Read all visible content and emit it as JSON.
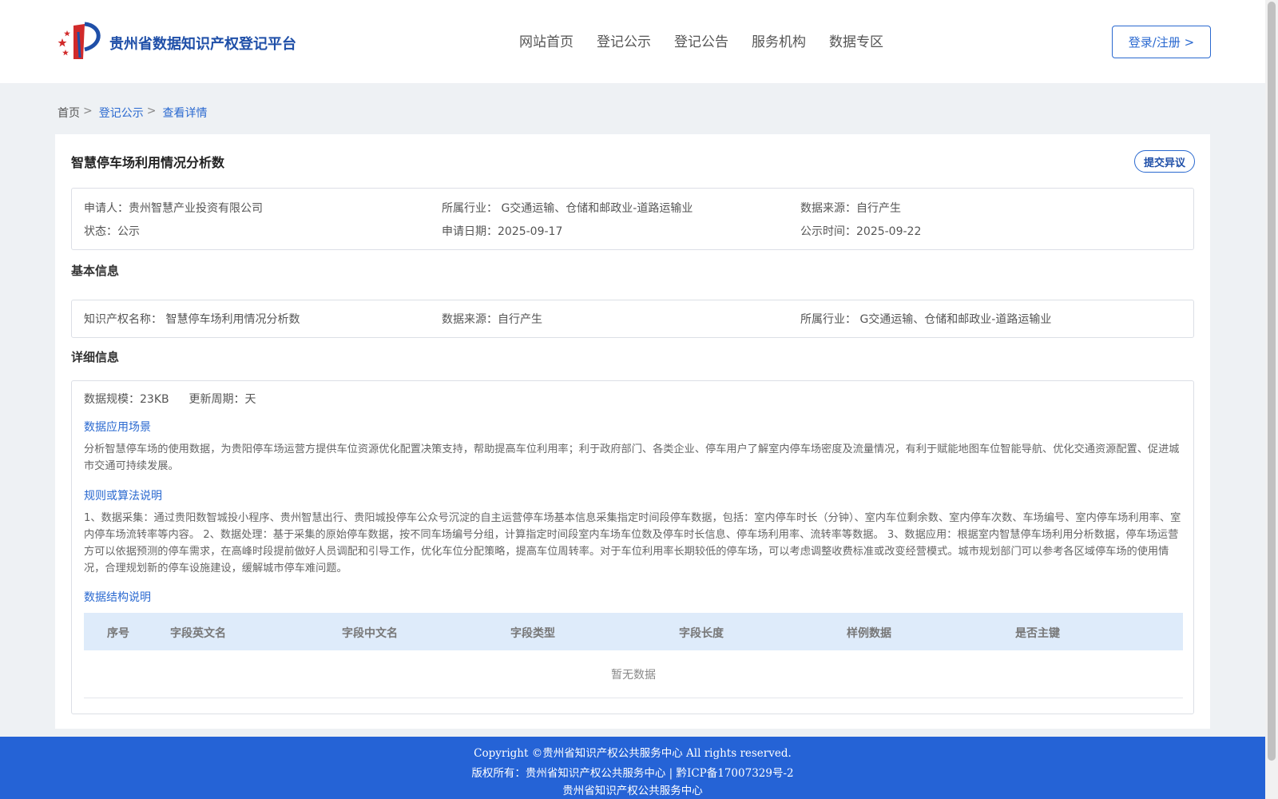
{
  "header": {
    "site_title": "贵州省数据知识产权登记平台",
    "nav": [
      "网站首页",
      "登记公示",
      "登记公告",
      "服务机构",
      "数据专区"
    ],
    "login_label": "登录/注册 >"
  },
  "breadcrumb": {
    "home": "首页",
    "sep": ">",
    "items": [
      "登记公示",
      "查看详情"
    ]
  },
  "record": {
    "title": "智慧停车场利用情况分析数",
    "objection_label": "提交异议",
    "meta": {
      "applicant_label": "申请人：",
      "applicant": "贵州智慧产业投资有限公司",
      "industry_label": "所属行业：",
      "industry": "G交通运输、仓储和邮政业-道路运输业",
      "source_label": "数据来源：",
      "source": "自行产生",
      "status_label": "状态：",
      "status": "公示",
      "apply_date_label": "申请日期：",
      "apply_date": "2025-09-17",
      "publish_time_label": "公示时间：",
      "publish_time": "2025-09-22"
    }
  },
  "basic_info": {
    "title": "基本信息",
    "ip_name_label": "知识产权名称：",
    "ip_name": "智慧停车场利用情况分析数",
    "source_label": "数据来源：",
    "source": "自行产生",
    "industry_label": "所属行业：",
    "industry": "G交通运输、仓储和邮政业-道路运输业"
  },
  "detail_info": {
    "title": "详细信息",
    "scale_label": "数据规模：",
    "scale": "23KB",
    "cycle_label": "更新周期：",
    "cycle": "天",
    "scenario_title": "数据应用场景",
    "scenario_text": "分析智慧停车场的使用数据，为贵阳停车场运营方提供车位资源优化配置决策支持，帮助提高车位利用率；利于政府部门、各类企业、停车用户了解室内停车场密度及流量情况，有利于赋能地图车位智能导航、优化交通资源配置、促进城市交通可持续发展。",
    "algorithm_title": "规则或算法说明",
    "algorithm_text": "1、数据采集：通过贵阳数智城投小程序、贵州智慧出行、贵阳城投停车公众号沉淀的自主运营停车场基本信息采集指定时间段停车数据，包括：室内停车时长（分钟）、室内车位剩余数、室内停车次数、车场编号、室内停车场利用率、室内停车场流转率等内容。 2、数据处理：基于采集的原始停车数据，按不同车场编号分组，计算指定时间段室内车场车位数及停车时长信息、停车场利用率、流转率等数据。 3、数据应用：根据室内智慧停车场利用分析数据，停车场运营方可以依据预测的停车需求，在高峰时段提前做好人员调配和引导工作，优化车位分配策略，提高车位周转率。对于车位利用率长期较低的停车场，可以考虑调整收费标准或改变经营模式。城市规划部门可以参考各区域停车场的使用情况，合理规划新的停车设施建设，缓解城市停车难问题。",
    "structure_title": "数据结构说明",
    "table_headers": [
      "序号",
      "字段英文名",
      "字段中文名",
      "字段类型",
      "字段长度",
      "样例数据",
      "是否主键"
    ],
    "table_empty": "暂无数据"
  },
  "footer": {
    "copyright": "Copyright ©贵州省知识产权公共服务中心 All rights reserved.",
    "owner": "版权所有：贵州省知识产权公共服务中心 | 黔ICP备17007329号-2",
    "org": "贵州省知识产权公共服务中心"
  },
  "colors": {
    "accent": "#2a69d0",
    "footer_bg": "#2563d6",
    "table_head_bg": "#deebfa"
  }
}
